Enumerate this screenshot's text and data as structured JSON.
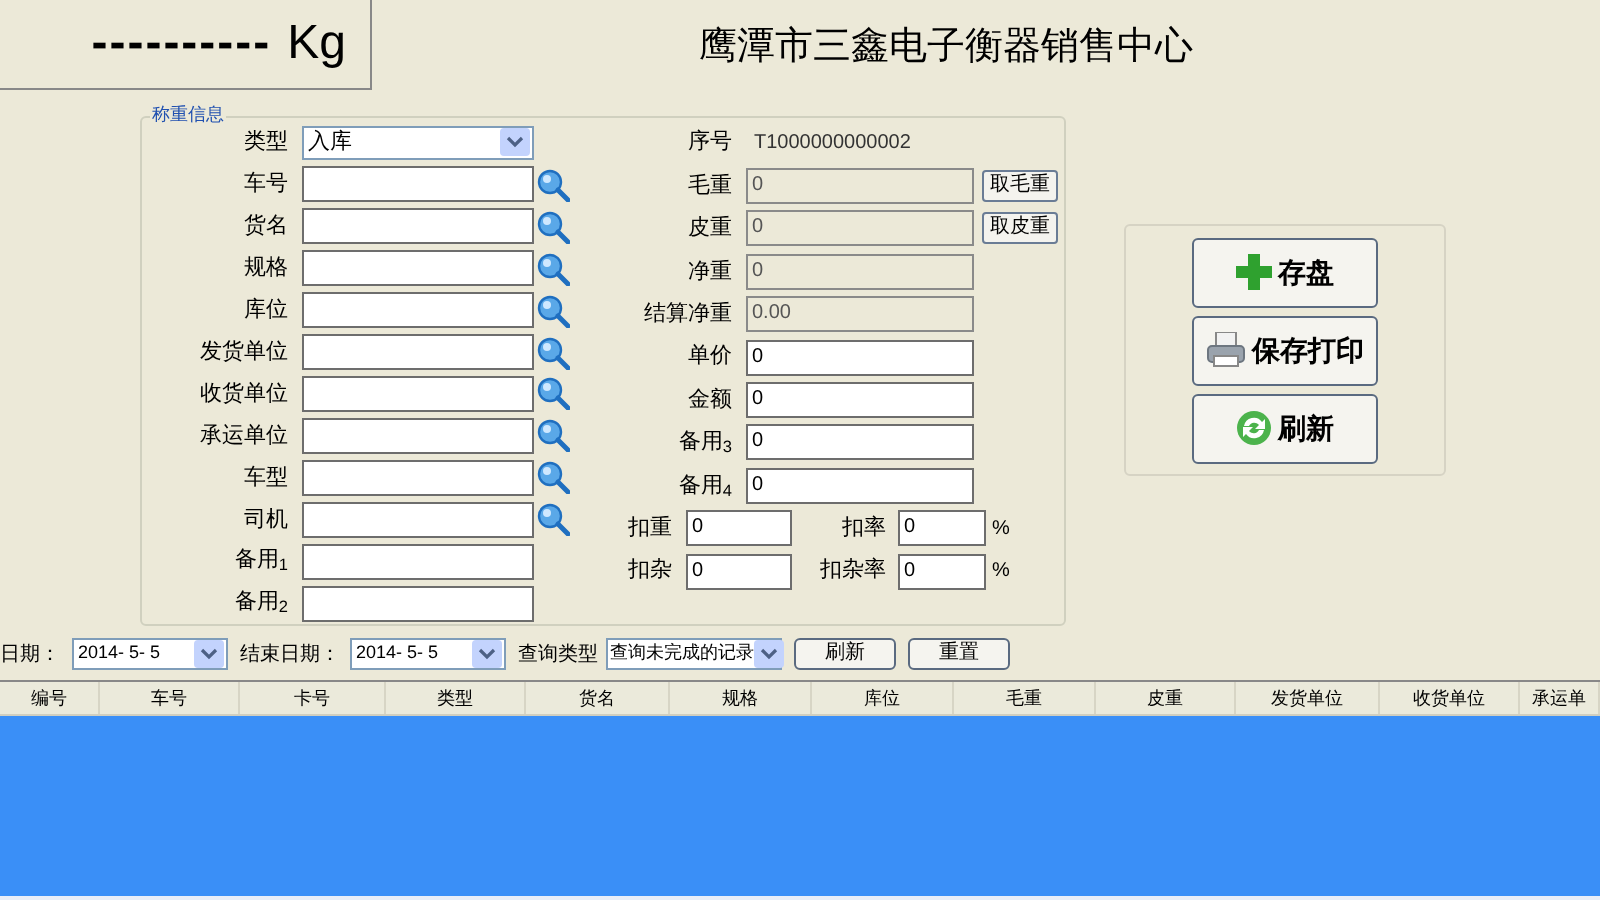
{
  "weight_display": {
    "reading": "----------",
    "unit": "Kg"
  },
  "title": "鹰潭市三鑫电子衡器销售中心",
  "group": {
    "legend": "称重信息",
    "left_fields": [
      {
        "kind": "select",
        "label": "类型",
        "value": "入库"
      },
      {
        "kind": "lookup",
        "label": "车号"
      },
      {
        "kind": "lookup",
        "label": "货名"
      },
      {
        "kind": "lookup",
        "label": "规格"
      },
      {
        "kind": "lookup",
        "label": "库位"
      },
      {
        "kind": "lookup",
        "label": "发货单位"
      },
      {
        "kind": "lookup",
        "label": "收货单位"
      },
      {
        "kind": "lookup",
        "label": "承运单位"
      },
      {
        "kind": "lookup",
        "label": "车型"
      },
      {
        "kind": "lookup",
        "label": "司机"
      },
      {
        "kind": "input",
        "label": "备用$_{1}$"
      },
      {
        "kind": "input",
        "label": "备用$_{2}$"
      }
    ],
    "right_fields": [
      {
        "kind": "text",
        "label": "序号",
        "value": "T1000000000002"
      },
      {
        "kind": "input",
        "label": "毛重",
        "value": "0",
        "readonly": true,
        "button": "取毛重"
      },
      {
        "kind": "input",
        "label": "皮重",
        "value": "0",
        "readonly": true,
        "button": "取皮重"
      },
      {
        "kind": "input",
        "label": "净重",
        "value": "0",
        "readonly": true
      },
      {
        "kind": "input",
        "label": "结算净重",
        "value": "0.00",
        "readonly": true
      },
      {
        "kind": "input",
        "label": "单价",
        "value": "0",
        "readonly": false
      },
      {
        "kind": "input",
        "label": "金额",
        "value": "0",
        "readonly": false
      },
      {
        "kind": "input",
        "label": "备用$_{3}$",
        "value": "0",
        "readonly": false
      },
      {
        "kind": "input",
        "label": "备用$_{4}$",
        "value": "0",
        "readonly": false
      }
    ],
    "deductions": [
      {
        "label": "扣重",
        "value": "0",
        "rate_label": "扣率",
        "rate_value": "0",
        "unit": "%"
      },
      {
        "label": "扣杂",
        "value": "0",
        "rate_label": "扣杂率",
        "rate_value": "0",
        "unit": "%"
      }
    ]
  },
  "actions": [
    {
      "kind": "add",
      "label": "存盘"
    },
    {
      "kind": "print",
      "label": "保存打印"
    },
    {
      "kind": "refresh",
      "label": "刷新"
    }
  ],
  "query": {
    "start_label": "日期：",
    "start_date": "2014- 5- 5",
    "end_label": "结束日期：",
    "end_date": "2014- 5- 5",
    "type_label": "查询类型",
    "type_value": "查询未完成的记录",
    "buttons": [
      "刷新",
      "重置"
    ]
  },
  "table": {
    "columns": [
      "编号",
      "车号",
      "卡号",
      "类型",
      "货名",
      "规格",
      "库位",
      "毛重",
      "皮重",
      "发货单位",
      "收货单位",
      "承运单"
    ]
  }
}
